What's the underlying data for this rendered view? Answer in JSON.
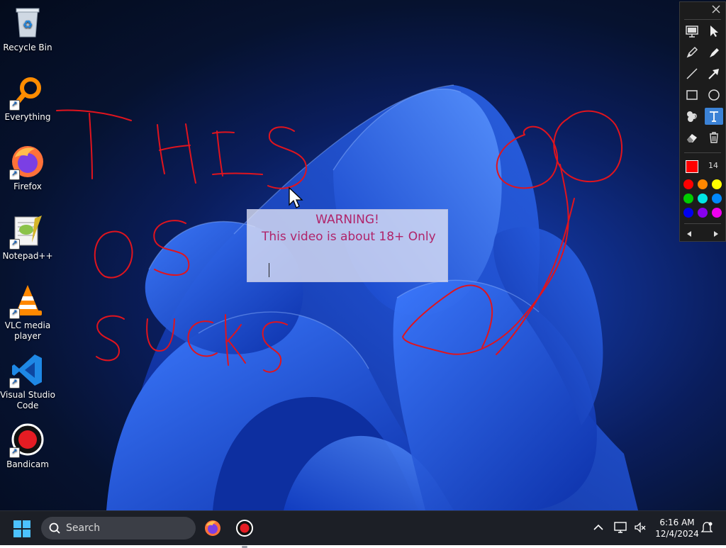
{
  "desktop": {
    "icons": [
      {
        "label": "Recycle Bin",
        "icon": "recycle-bin-icon"
      },
      {
        "label": "Everything",
        "icon": "everything-search-icon"
      },
      {
        "label": "Firefox",
        "icon": "firefox-icon"
      },
      {
        "label": "Notepad++",
        "icon": "notepad-plus-plus-icon"
      },
      {
        "label": "VLC media player",
        "icon": "vlc-icon"
      },
      {
        "label": "Visual Studio Code",
        "icon": "vscode-icon"
      },
      {
        "label": "Bandicam",
        "icon": "bandicam-icon"
      }
    ]
  },
  "annotation": {
    "ink_color": "#e0141e",
    "freehand_text": [
      "THIS",
      "OS",
      "SUCKS"
    ],
    "textbox": {
      "line1": "WARNING!",
      "line2": "This video is about 18+ Only",
      "text_color": "#b0246a"
    }
  },
  "toolbar": {
    "tools": [
      "presentation-icon",
      "pointer-icon",
      "pencil-icon",
      "marker-icon",
      "line-icon",
      "arrow-icon",
      "rectangle-icon",
      "ellipse-icon",
      "stamp-icon",
      "text-tool-icon",
      "eraser-icon",
      "trash-icon"
    ],
    "active_tool": "text",
    "current_color": "#ff0000",
    "size": "14",
    "palette": [
      "#ff0000",
      "#ff8800",
      "#ffff00",
      "#00cc00",
      "#00e5e5",
      "#0088ff",
      "#0000ee",
      "#8800ee",
      "#ee00ee"
    ]
  },
  "taskbar": {
    "search_placeholder": "Search",
    "time": "6:16 AM",
    "date": "12/4/2024",
    "pinned": [
      "firefox-icon",
      "bandicam-icon"
    ],
    "accent": "#1c1f26"
  }
}
